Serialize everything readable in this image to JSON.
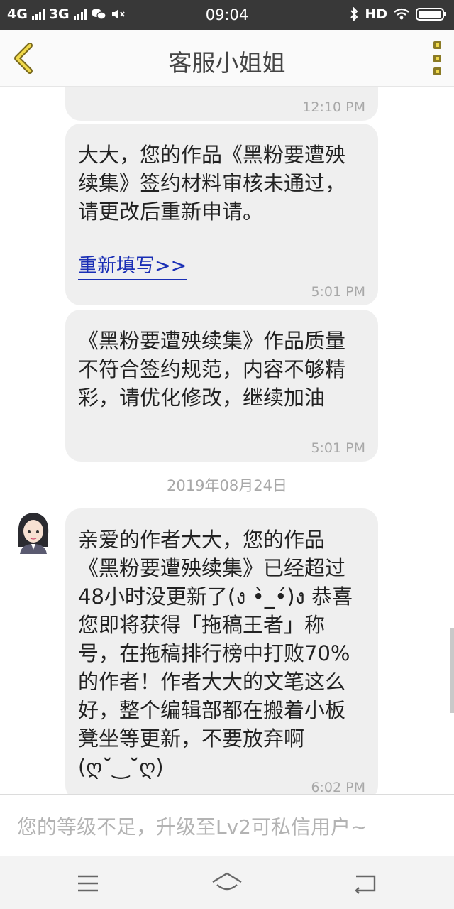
{
  "status_bar": {
    "network_1": "4G",
    "network_2": "3G",
    "time": "09:04",
    "hd": "HD"
  },
  "header": {
    "title": "客服小姐姐",
    "back_icon": "chevron-left-icon",
    "more_icon": "more-vertical-icon"
  },
  "messages": [
    {
      "time": "12:10 PM"
    },
    {
      "text": " 大大，您的作品《黑粉要遭殃续集》签约材料审核未通过，请更改后重新申请。",
      "link": "重新填写>>",
      "time": "5:01 PM"
    },
    {
      "text": "《黑粉要遭殃续集》作品质量不符合签约规范，内容不够精彩，请优化修改，继续加油",
      "time": "5:01 PM"
    },
    {
      "text": "亲爱的作者大大，您的作品《黑粉要遭殃续集》已经超过48小时没更新了(ง •̀_•́)ง 恭喜您即将获得「拖稿王者」称号，在拖稿排行榜中打败70%的作者！作者大大的文笔这么好，整个编辑部都在搬着小板凳坐等更新，不要放弃啊(ღ˘‿˘ღ)",
      "time": "6:02 PM"
    }
  ],
  "date_separator": "2019年08月24日",
  "input": {
    "placeholder": "您的等级不足，升级至Lv2可私信用户~"
  },
  "nav_bar": {
    "icons": [
      "menu-icon",
      "home-icon",
      "back-icon"
    ]
  },
  "colors": {
    "status_bar": "#383838",
    "accent_yellow": "#f0d94a",
    "link": "#1a2fb5",
    "bubble": "#efefef"
  }
}
